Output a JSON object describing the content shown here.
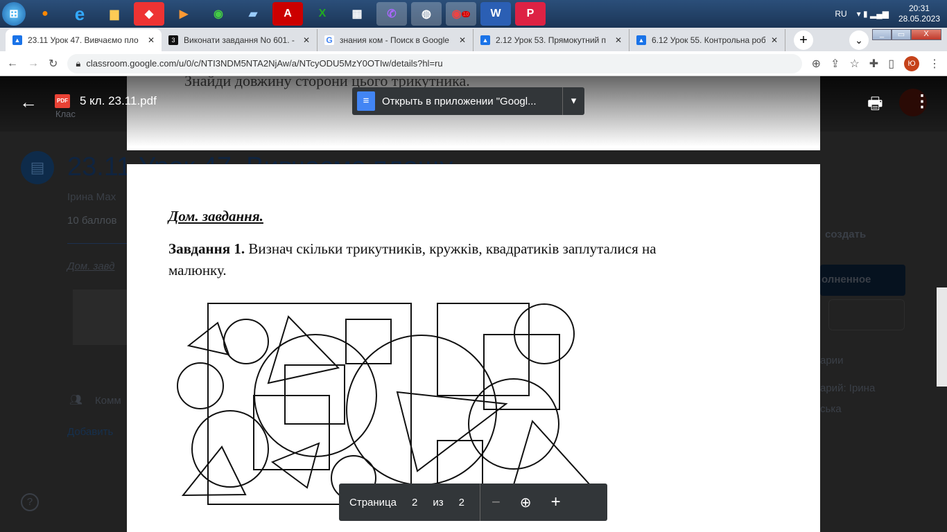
{
  "taskbar": {
    "icons": [
      "start-orb",
      "firefox",
      "internet-explorer",
      "file-explorer",
      "anydesk",
      "media-player",
      "chrome",
      "notepad",
      "acrobat",
      "excel",
      "calculator",
      "viber",
      "speaker",
      "chrome-badge",
      "word",
      "powerpoint"
    ],
    "lang": "RU",
    "time": "20:31",
    "date": "28.05.2023",
    "chrome_badge": "10"
  },
  "tabs": [
    {
      "title": "23.11 Урок 47. Вивчаємо пло",
      "icon": "classroom"
    },
    {
      "title": "Виконати завдання No 601. -",
      "icon": "3"
    },
    {
      "title": "знания ком - Поиск в Google",
      "icon": "G"
    },
    {
      "title": "2.12 Урок 53. Прямокутний п",
      "icon": "classroom"
    },
    {
      "title": "6.12 Урок 55. Контрольна роб",
      "icon": "classroom"
    }
  ],
  "address": {
    "url": "classroom.google.com/u/0/c/NTI3NDM5NTA2NjAw/a/NTcyODU5MzY0OTIw/details?hl=ru",
    "profile": "Ю"
  },
  "background": {
    "class_label": "Клас",
    "title": "23.11 Урок 47. Вивчаємо площу",
    "author": "Ірина Мах",
    "points": "10 баллов",
    "link": "Дом. завд",
    "comments": "Комм",
    "add": "Добавить",
    "create": "создать",
    "done": "олненное",
    "side_comments": "арии",
    "side_comment2": "арий: Ірина",
    "side_comment3": "ська",
    "help": "?"
  },
  "viewer": {
    "file_name": "5 кл. 23.11.pdf",
    "file_badge": "PDF",
    "open_with": "Открыть в приложении \"Googl...",
    "avatar": "Ю"
  },
  "pdf": {
    "prev_text": "Знайди довжину сторони цього трикутника.",
    "heading": "Дом. завдання.",
    "task_bold": "Завдання 1.",
    "task_text": " Визнач скільки трикутників, кружків, квадратиків заплуталися на",
    "task_text2": "малюнку."
  },
  "pager": {
    "label": "Страница",
    "current": "2",
    "of": "из",
    "total": "2"
  }
}
